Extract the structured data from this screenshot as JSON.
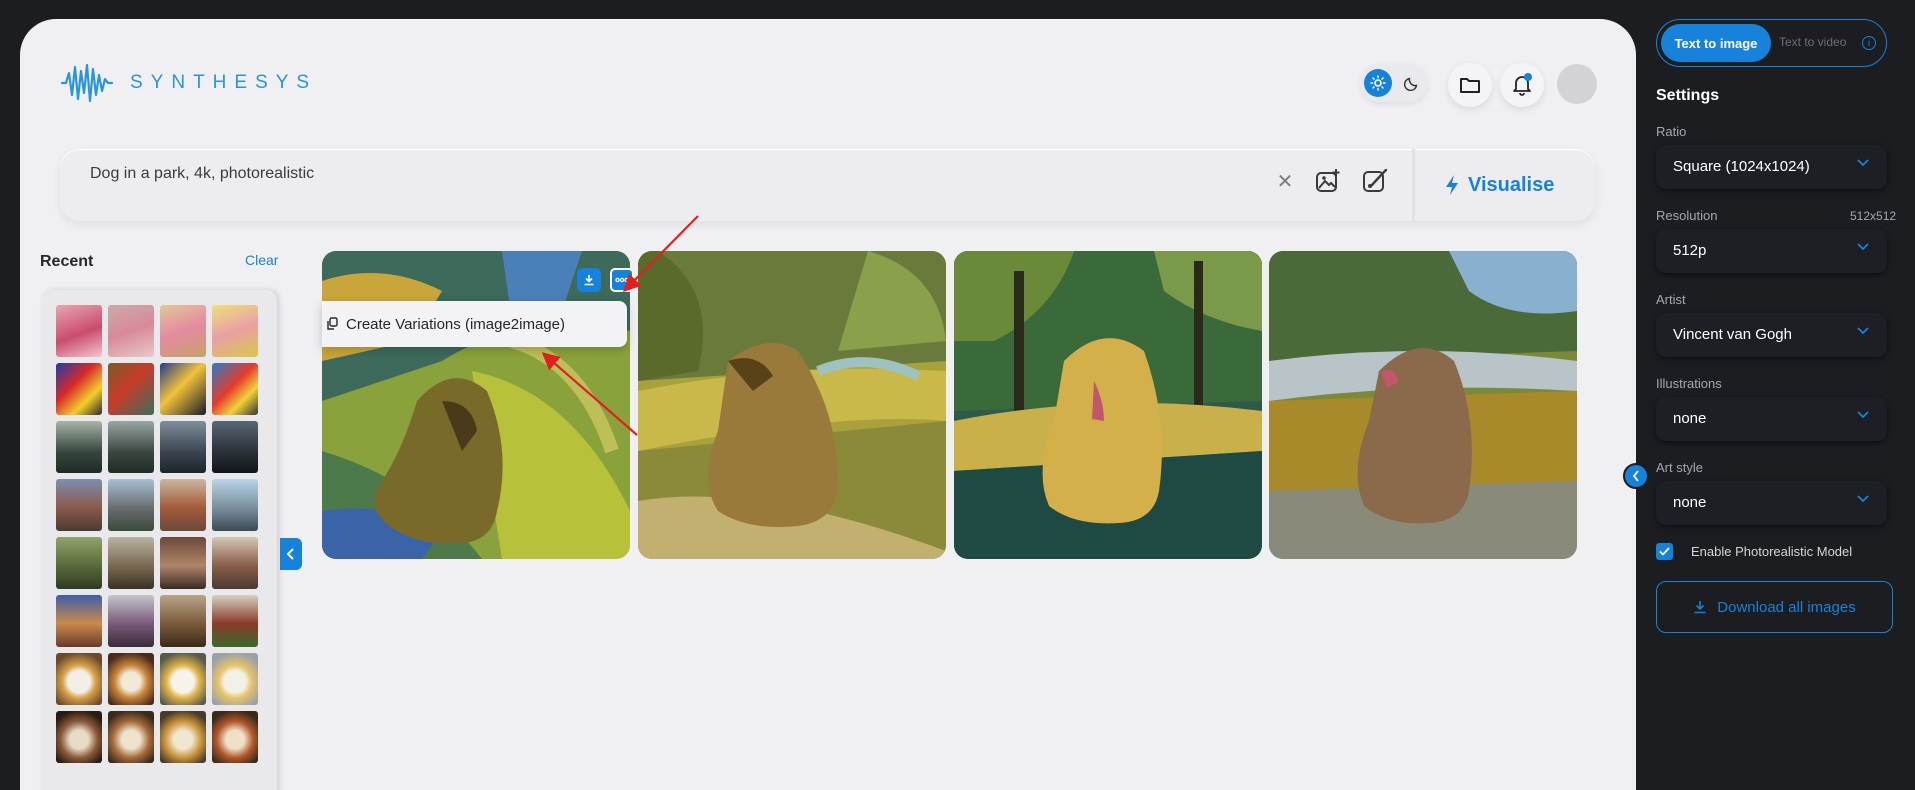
{
  "brand": {
    "name": "SYNTHESYS",
    "accent": "#1782d9"
  },
  "prompt": {
    "value": "Dog in a park, 4k, photorealistic",
    "clear_icon": "close-icon",
    "action_label": "Visualise"
  },
  "recent": {
    "title": "Recent",
    "clear_label": "Clear"
  },
  "gallery": {
    "context_menu": {
      "item_label": "Create Variations (image2image)"
    }
  },
  "header": {
    "theme": "light"
  },
  "settings": {
    "mode_active": "Text to image",
    "mode_inactive": "Text to video",
    "title": "Settings",
    "ratio": {
      "label": "Ratio",
      "value": "Square (1024x1024)"
    },
    "resolution": {
      "label": "Resolution",
      "aside": "512x512",
      "value": "512p"
    },
    "artist": {
      "label": "Artist",
      "value": "Vincent van Gogh"
    },
    "illustrations": {
      "label": "Illustrations",
      "value": "none"
    },
    "art_style": {
      "label": "Art style",
      "value": "none"
    },
    "photorealistic": {
      "label": "Enable Photorealistic Model",
      "checked": true
    },
    "download_all": "Download all images"
  }
}
